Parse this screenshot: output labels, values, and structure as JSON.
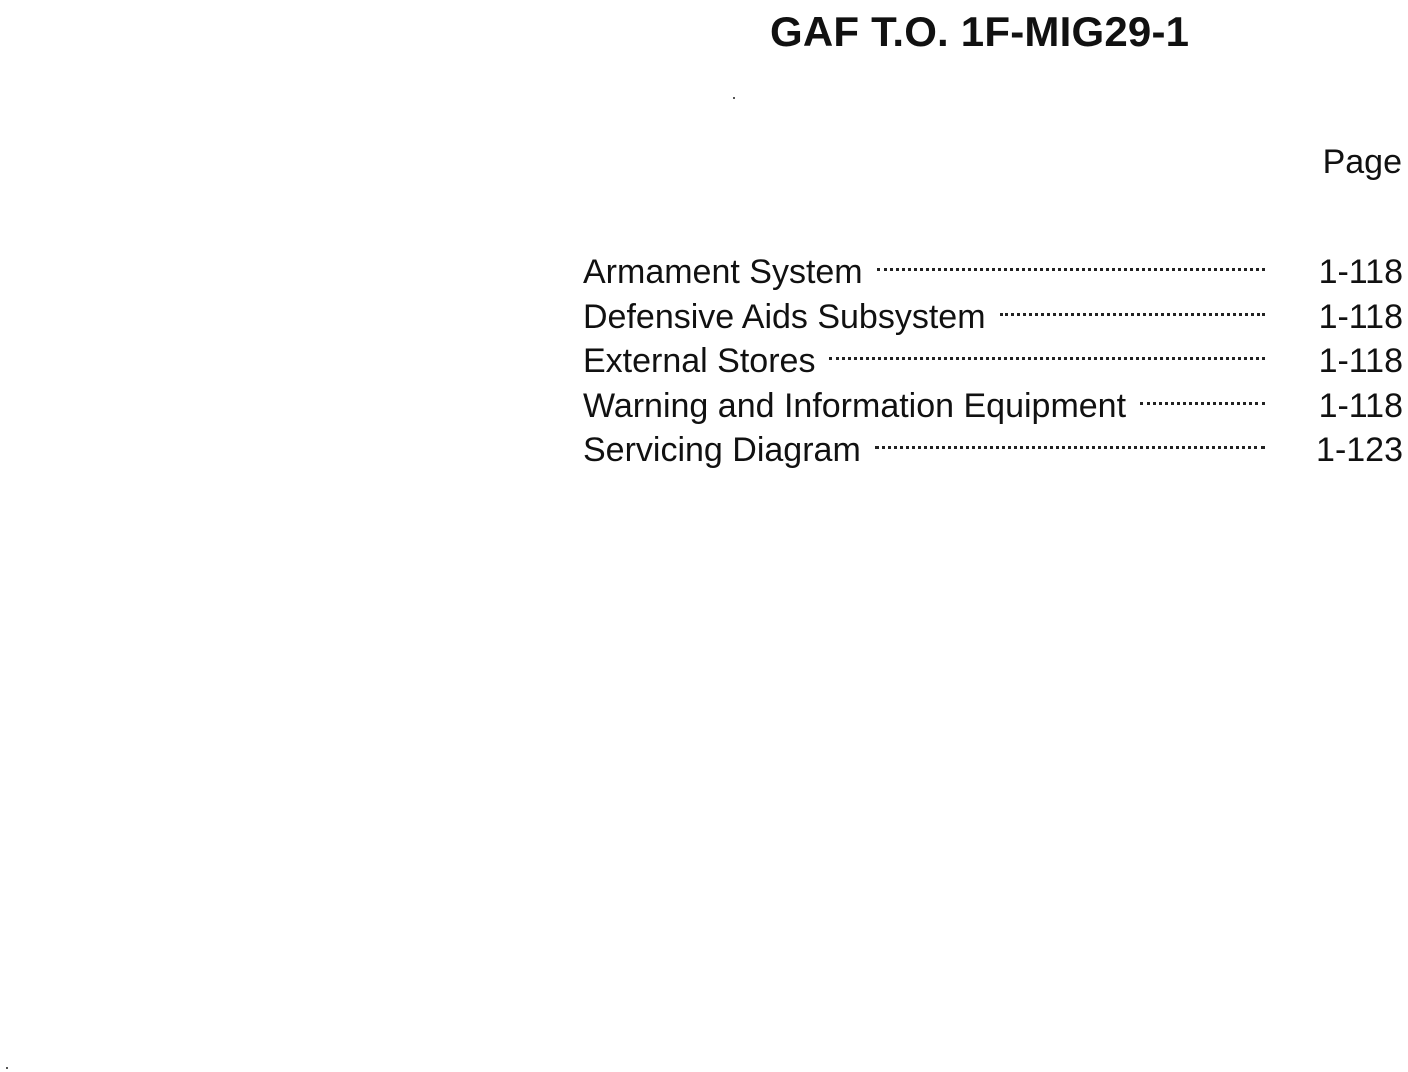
{
  "header": {
    "title": "GAF T.O. 1F-MIG29-1"
  },
  "toc": {
    "page_label": "Page",
    "entries": [
      {
        "title": "Armament System",
        "page": "1-118"
      },
      {
        "title": "Defensive Aids Subsystem",
        "page": "1-118"
      },
      {
        "title": "External Stores",
        "page": "1-118"
      },
      {
        "title": "Warning and Information Equipment",
        "page": "1-118"
      },
      {
        "title": "Servicing Diagram",
        "page": "1-123"
      }
    ]
  }
}
